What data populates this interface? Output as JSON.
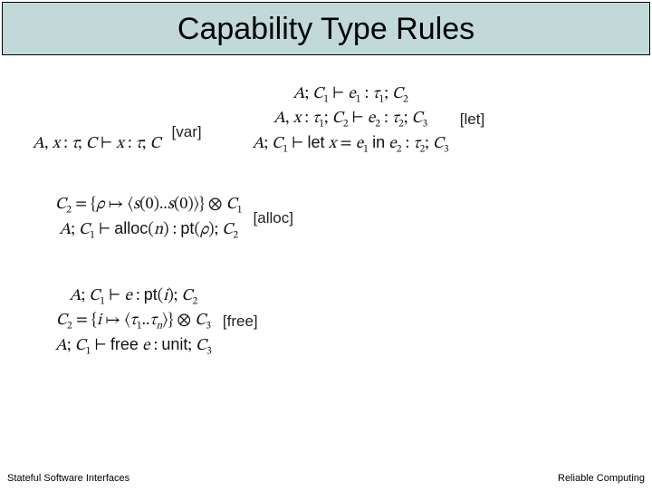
{
  "title": "Capability Type Rules",
  "rules": {
    "var": {
      "name": "[var]",
      "premise": "",
      "conclusion_math": "A, x : τ; C ⊢ x : τ; C"
    },
    "let": {
      "name": "[let]",
      "premise1": "A; C₁ ⊢ e₁ : τ₁; C₂",
      "premise2": "A, x : τ₁; C₂ ⊢ e₂ : τ₂; C₃",
      "conclusion": "A; C₁ ⊢ let x = e₁ in e₂ : τ₂; C₃"
    },
    "alloc": {
      "name": "[alloc]",
      "premise": "C₂ = {ρ ↦ ⟨s(0)..s(0)⟩} ⊗ C₁",
      "conclusion": "A; C₁ ⊢ alloc(n) : pt(ρ); C₂"
    },
    "free": {
      "name": "[free]",
      "premise1": "A; C₁ ⊢ e : pt(i); C₂",
      "premise2": "C₂ = {i ↦ ⟨τ₁..τₙ⟩} ⊗ C₃",
      "conclusion": "A; C₁ ⊢ free e : unit; C₃"
    }
  },
  "footer": {
    "left": "Stateful Software Interfaces",
    "right": "Reliable Computing"
  }
}
